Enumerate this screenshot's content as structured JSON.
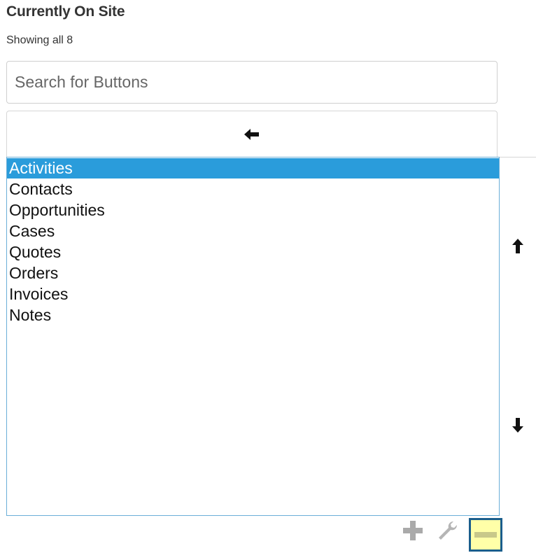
{
  "header": {
    "title": "Currently On Site",
    "subtitle": "Showing all 8"
  },
  "search": {
    "placeholder": "Search for Buttons",
    "value": ""
  },
  "buttons": {
    "move_left_icon": "arrow-left-icon",
    "move_up_icon": "arrow-up-icon",
    "move_down_icon": "arrow-down-icon"
  },
  "list": {
    "selected_index": 0,
    "items": [
      "Activities",
      "Contacts",
      "Opportunities",
      "Cases",
      "Quotes",
      "Orders",
      "Invoices",
      "Notes"
    ]
  },
  "toolbar": {
    "add_icon": "plus-icon",
    "settings_icon": "wrench-icon",
    "remove_icon": "minus-icon"
  },
  "colors": {
    "selection": "#2a9cdb",
    "list_border": "#6aaed8",
    "highlight_fill": "#ffffa8",
    "highlight_border": "#1b5e8c",
    "toolbar_icon": "#aaaaaa"
  }
}
